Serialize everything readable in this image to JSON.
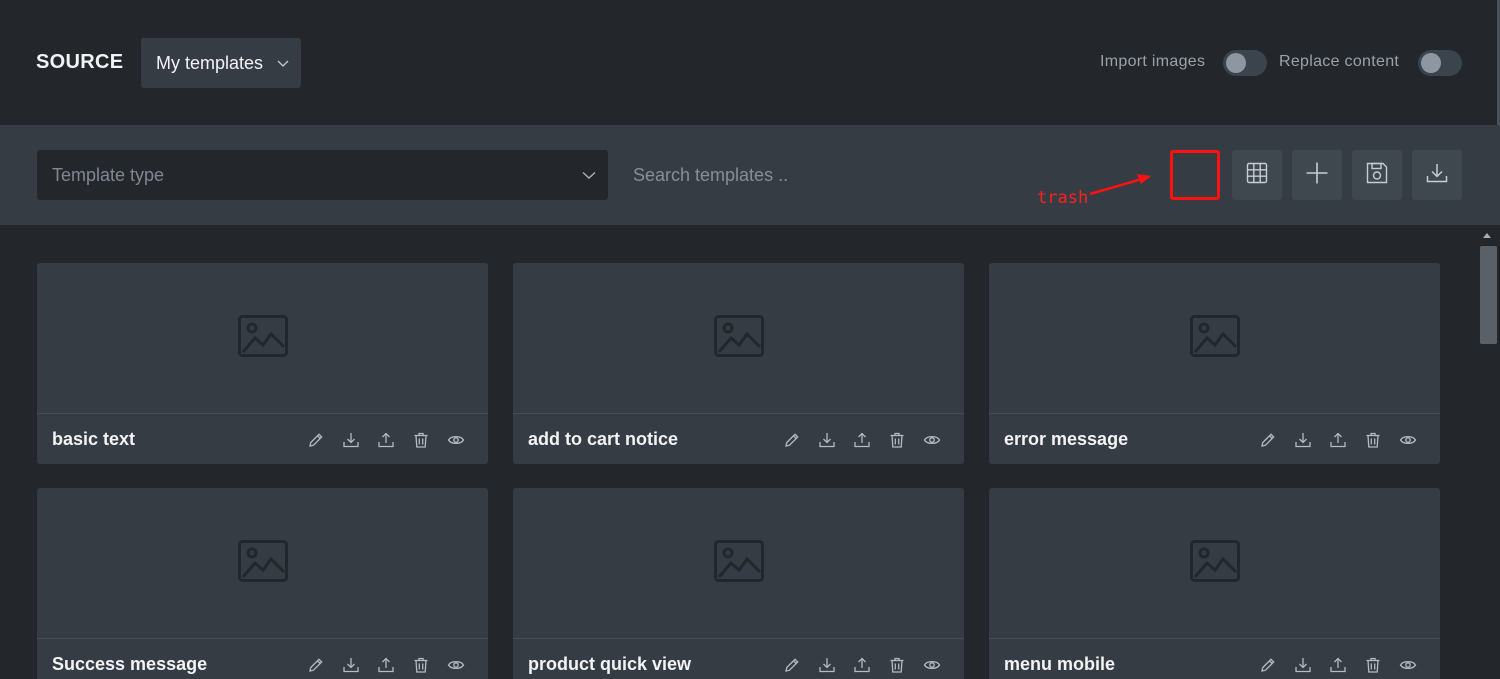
{
  "header": {
    "source_label": "SOURCE",
    "source_select": "My templates",
    "import_images_label": "Import images",
    "import_images_on": false,
    "replace_content_label": "Replace content",
    "replace_content_on": false
  },
  "toolbar": {
    "template_type_placeholder": "Template type",
    "search_placeholder": "Search templates ..",
    "buttons": [
      "trash-icon",
      "grid-icon",
      "plus-icon",
      "save-icon",
      "download-icon"
    ]
  },
  "annotation": {
    "label": "trash",
    "color": "#ff1111"
  },
  "templates": [
    {
      "name": "basic text"
    },
    {
      "name": "add to cart notice"
    },
    {
      "name": "error message"
    },
    {
      "name": "Success message"
    },
    {
      "name": "product quick view"
    },
    {
      "name": "menu mobile"
    }
  ],
  "card_actions": [
    "edit-icon",
    "download-icon",
    "upload-icon",
    "trash-icon",
    "eye-icon"
  ],
  "colors": {
    "background": "#23272b",
    "panel": "#353c44",
    "button": "#3f474f",
    "text": "#f1f3f5",
    "muted": "#9aa1a9"
  }
}
